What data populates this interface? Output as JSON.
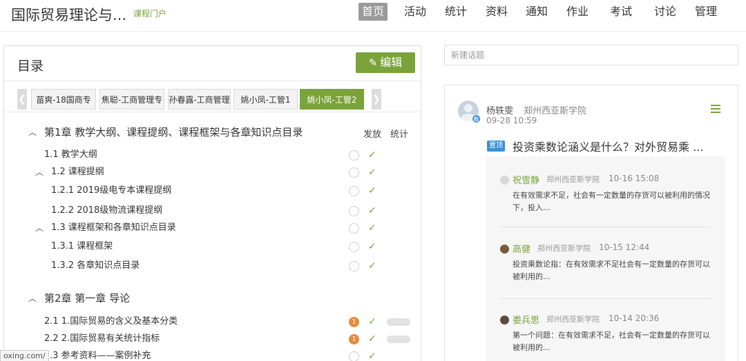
{
  "header": {
    "course_title": "国际贸易理论与...",
    "portal_link": "课程门户",
    "nav": [
      "首页",
      "活动",
      "统计",
      "资料",
      "通知",
      "作业",
      "考试",
      "讨论",
      "管理"
    ]
  },
  "toc": {
    "title": "目录",
    "edit_label": "编辑",
    "tabs": [
      "苗爽-18国商专",
      "焦聪-工商管理专",
      "孙春露-工商管理",
      "姚小凤-工管1",
      "姚小凤-工管2"
    ],
    "col_publish": "发放",
    "col_stats": "统计",
    "rows": [
      {
        "label": "第1章 教学大纲、课程提纲、课程框架与各章知识点目录"
      },
      {
        "label": "1.1  教学大纲"
      },
      {
        "label": "1.2  课程提纲"
      },
      {
        "label": "1.2.1 2019级电专本课程提纲"
      },
      {
        "label": "1.2.2 2018级物流课程提纲"
      },
      {
        "label": "1.3  课程框架和各章知识点目录"
      },
      {
        "label": "1.3.1 课程框架"
      },
      {
        "label": "1.3.2 各章知识点目录"
      },
      {
        "label": "第2章 第一章 导论"
      },
      {
        "label": "2.1  1.国际贸易的含义及基本分类",
        "badge": "1"
      },
      {
        "label": "2.2  2.国际贸易有关统计指标",
        "badge": "1"
      },
      {
        "label": ".3  参考资料——案例补充"
      }
    ],
    "url_tip": "oxing.com/"
  },
  "discussion": {
    "new_topic_placeholder": "新建话题",
    "author": "杨轶雯",
    "school": "郑州西亚斯学院",
    "time": "09-28 10:59",
    "teacher_badge": "教",
    "pin_tag": "置顶",
    "title": "投资乘数论涵义是什么？对外贸易乘 ...",
    "replies": [
      {
        "name": "祝雪静",
        "school": "郑州西亚斯学院",
        "time": "10-16 15:08",
        "text": "在有效需求不足，社会有一定数量的存货可以被利用的情况下，投入..."
      },
      {
        "name": "高健",
        "school": "郑州西亚斯学院",
        "time": "10-15 12:44",
        "text": "投资乘数论指：在有效需求不足社会有一定数量的存货可以被利用的..."
      },
      {
        "name": "娄兵思",
        "school": "郑州西亚斯学院",
        "time": "10-14 20:36",
        "text": "第一个问题：在有效需求不足，社会有一定数量的存货可以被利用的..."
      }
    ]
  },
  "colors": {
    "accent": "#7aa33a",
    "badge_orange": "#e88a3a",
    "pin_blue": "#3a8fd8"
  },
  "icons": {
    "edit": "pencil-icon",
    "menu": "menu-icon",
    "expand": "chevron-up-icon",
    "status": "check-icon"
  }
}
